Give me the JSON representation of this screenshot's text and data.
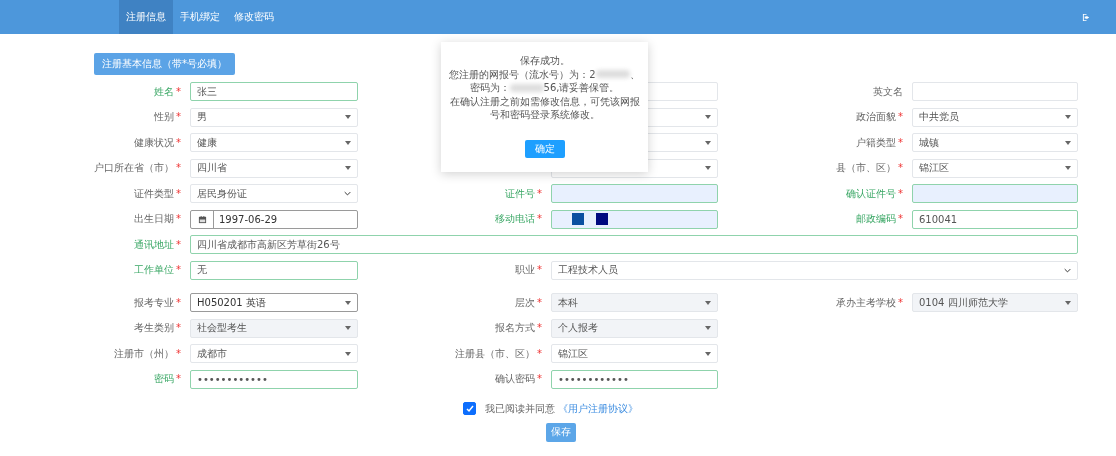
{
  "nav": {
    "tabs": [
      {
        "label": "注册信息",
        "selected": true
      },
      {
        "label": "手机绑定",
        "selected": false
      },
      {
        "label": "修改密码",
        "selected": false
      }
    ]
  },
  "section_title": "注册基本信息（带*号必填）",
  "groups": [
    {
      "rows": [
        {
          "cells": [
            {
              "label": "姓名",
              "required_mark": "*",
              "label_ok": true,
              "field": {
                "kind": "text",
                "value": "张三",
                "validated": true
              }
            },
            {
              "field": {
                "kind": "text",
                "validated": false
              }
            },
            {
              "label": "英文名",
              "label_ok": false,
              "field": {
                "kind": "text",
                "validated": false
              }
            }
          ]
        },
        {
          "cells": [
            {
              "label": "性别",
              "required_mark": "*",
              "label_ok": false,
              "field": {
                "kind": "select",
                "value": "男",
                "validated": false
              }
            },
            {
              "field": {
                "kind": "select",
                "validated": false
              }
            },
            {
              "label": "政治面貌",
              "required_mark": "*",
              "label_ok": false,
              "field": {
                "kind": "select",
                "value": "中共党员",
                "validated": false
              }
            }
          ]
        },
        {
          "cells": [
            {
              "label": "健康状况",
              "required_mark": "*",
              "label_ok": false,
              "field": {
                "kind": "select",
                "value": "健康",
                "validated": false
              }
            },
            {
              "field": {
                "kind": "select",
                "validated": false
              }
            },
            {
              "label": "户籍类型",
              "required_mark": "*",
              "label_ok": false,
              "field": {
                "kind": "select",
                "value": "城镇",
                "validated": false
              }
            }
          ]
        },
        {
          "cells": [
            {
              "label": "户口所在省（市）",
              "required_mark": "*",
              "label_ok": false,
              "field": {
                "kind": "select",
                "value": "四川省",
                "validated": false
              }
            },
            {
              "field": {
                "kind": "select",
                "validated": false
              }
            },
            {
              "label": "县（市、区）",
              "required_mark": "*",
              "label_ok": false,
              "field": {
                "kind": "select",
                "value": "锦江区",
                "validated": false
              }
            }
          ]
        },
        {
          "cells": [
            {
              "label": "证件类型",
              "required_mark": "*",
              "label_ok": false,
              "field": {
                "kind": "native-select",
                "value": "居民身份证",
                "validated": false
              }
            },
            {
              "label": "证件号",
              "required_mark": "*",
              "label_ok": true,
              "field": {
                "kind": "text",
                "validated": true,
                "autofilled": true
              }
            },
            {
              "label": "确认证件号",
              "required_mark": "*",
              "label_ok": true,
              "field": {
                "kind": "text",
                "validated": true,
                "autofilled": true
              }
            }
          ]
        },
        {
          "cells": [
            {
              "label": "出生日期",
              "required_mark": "*",
              "label_ok": false,
              "field": {
                "kind": "date",
                "value": "1997-06-29",
                "validated": false
              }
            },
            {
              "label": "移动电话",
              "required_mark": "*",
              "label_ok": true,
              "field": {
                "kind": "text",
                "validated": true,
                "autofilled": true
              }
            },
            {
              "label": "邮政编码",
              "required_mark": "*",
              "label_ok": true,
              "field": {
                "kind": "text",
                "value": "610041",
                "validated": true
              }
            }
          ]
        },
        {
          "cells": [
            {
              "label": "通讯地址",
              "required_mark": "*",
              "label_ok": true,
              "kind": "wide",
              "field": {
                "kind": "text",
                "value": "四川省成都市高新区芳草街26号",
                "validated": true
              }
            }
          ]
        },
        {
          "cells": [
            {
              "label": "工作单位",
              "required_mark": "*",
              "label_ok": true,
              "field": {
                "kind": "text",
                "value": "无",
                "validated": true
              }
            },
            {
              "label": "职业",
              "required_mark": "*",
              "label_ok": false,
              "kind": "wide",
              "field": {
                "kind": "native-select",
                "value": "工程技术人员",
                "validated": false
              }
            }
          ]
        }
      ]
    },
    {
      "rows": [
        {
          "cells": [
            {
              "label": "报考专业",
              "required_mark": "*",
              "label_ok": false,
              "field": {
                "kind": "combo",
                "value": "H050201 英语",
                "validated": false
              }
            },
            {
              "label": "层次",
              "required_mark": "*",
              "label_ok": false,
              "field": {
                "kind": "select",
                "value": "本科",
                "disabled": true,
                "validated": false
              }
            },
            {
              "label": "承办主考学校",
              "required_mark": "*",
              "label_ok": false,
              "field": {
                "kind": "select",
                "value": "0104 四川师范大学",
                "disabled": true,
                "validated": false
              }
            }
          ]
        },
        {
          "cells": [
            {
              "label": "考生类别",
              "required_mark": "*",
              "label_ok": false,
              "field": {
                "kind": "select",
                "value": "社会型考生",
                "disabled": true,
                "validated": false
              }
            },
            {
              "label": "报名方式",
              "required_mark": "*",
              "label_ok": false,
              "field": {
                "kind": "select",
                "value": "个人报考",
                "disabled": true,
                "validated": false
              }
            }
          ]
        },
        {
          "cells": [
            {
              "label": "注册市（州）",
              "required_mark": "*",
              "label_ok": false,
              "field": {
                "kind": "select",
                "value": "成都市",
                "validated": false
              }
            },
            {
              "label": "注册县（市、区）",
              "required_mark": "*",
              "label_ok": false,
              "field": {
                "kind": "select",
                "value": "锦江区",
                "validated": false
              }
            }
          ]
        },
        {
          "cells": [
            {
              "label": "密码",
              "required_mark": "*",
              "label_ok": true,
              "field": {
                "kind": "text",
                "value": "••••••••••••",
                "validated": true
              }
            },
            {
              "label": "确认密码",
              "required_mark": "*",
              "label_ok": false,
              "field": {
                "kind": "text",
                "value": "••••••••••••",
                "validated": true
              }
            }
          ]
        }
      ]
    }
  ],
  "agreement": {
    "checked": true,
    "text": "我已阅读并同意",
    "link": "《用户注册协议》"
  },
  "save_button": "保存",
  "dialog": {
    "lines": [
      [
        "保存成功。"
      ],
      [
        "您注册的网报号（流水号）为：2",
        "、"
      ],
      [
        "密码为：",
        "56,请妥善保管。"
      ],
      [
        "在确认注册之前如需修改信息，可凭该网报号和密码登录系统修改。"
      ]
    ],
    "button": "确定"
  }
}
